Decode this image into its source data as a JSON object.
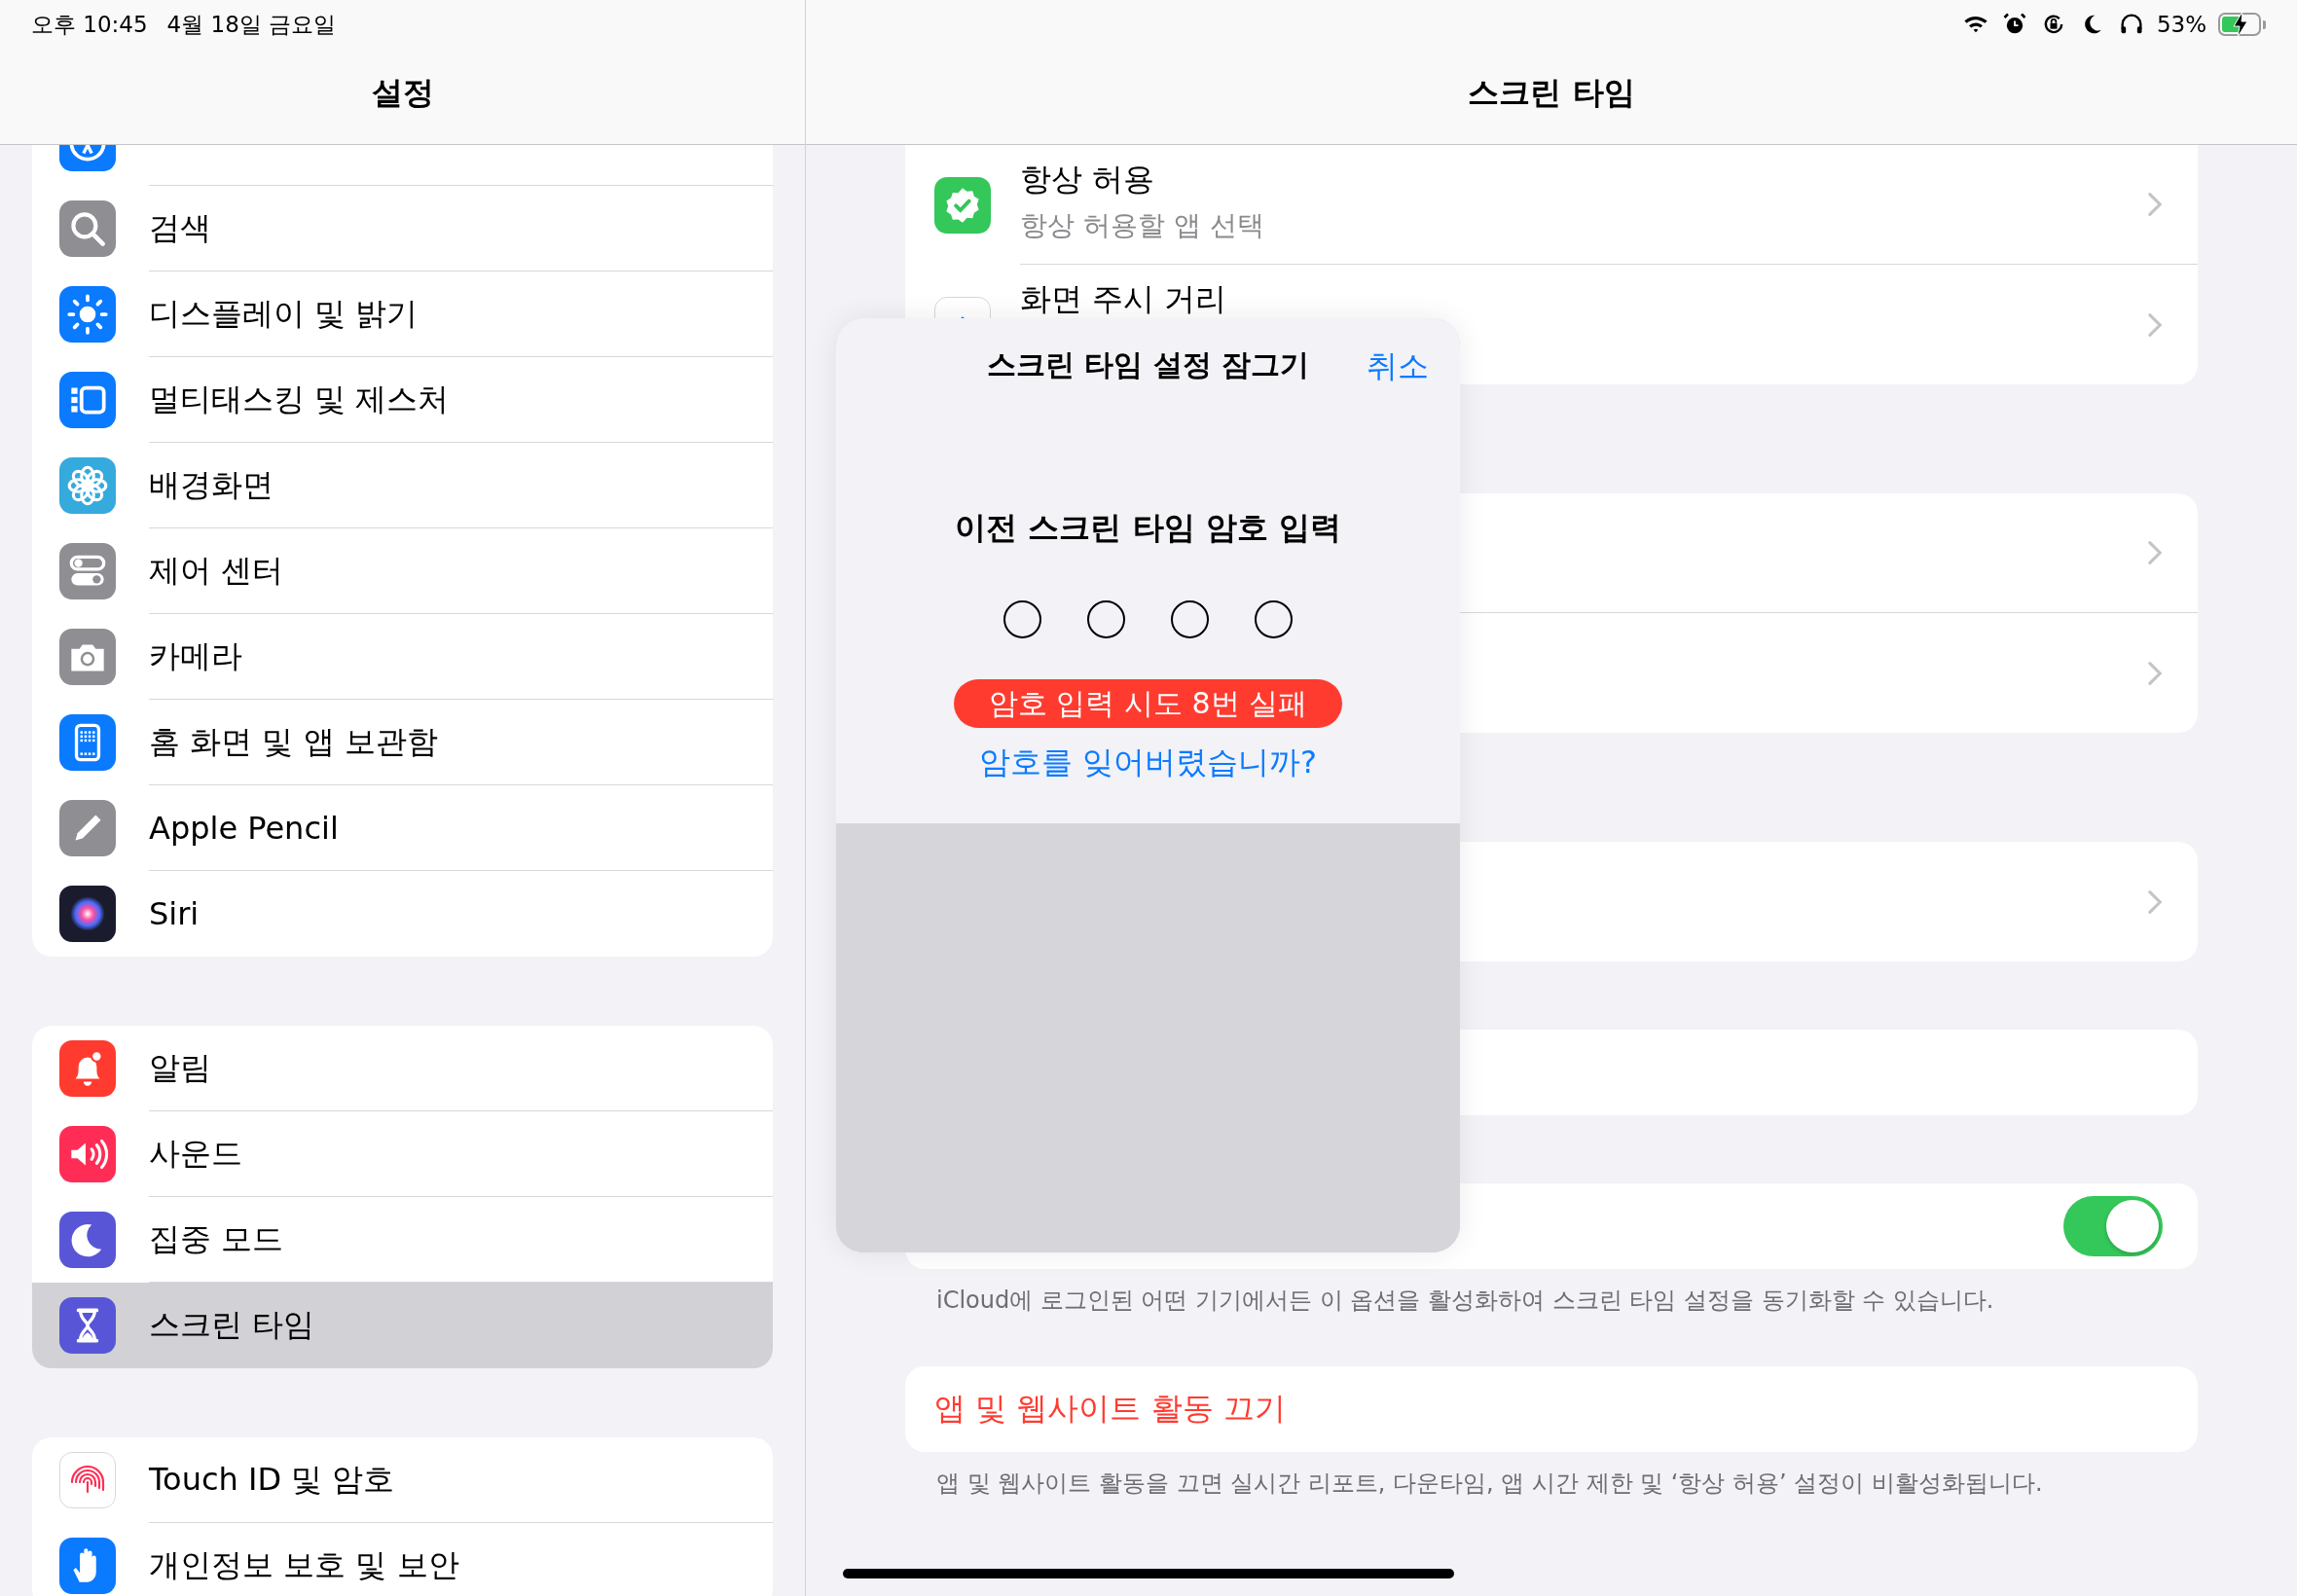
{
  "status_bar": {
    "time": "오후 10:45",
    "date": "4월 18일 금요일",
    "battery": "53%"
  },
  "sidebar": {
    "title": "설정",
    "groups": [
      {
        "items": [
          {
            "selected": false
          },
          {
            "label": "검색",
            "selected": false
          },
          {
            "label": "디스플레이 및 밝기",
            "selected": false
          },
          {
            "label": "멀티태스킹 및 제스처",
            "selected": false
          },
          {
            "label": "배경화면",
            "selected": false
          },
          {
            "label": "제어 센터",
            "selected": false
          },
          {
            "label": "카메라",
            "selected": false
          },
          {
            "label": "홈 화면 및 앱 보관함",
            "selected": false
          },
          {
            "label": "Apple Pencil",
            "selected": false
          },
          {
            "label": "Siri",
            "selected": false
          }
        ]
      },
      {
        "items": [
          {
            "label": "알림",
            "selected": false
          },
          {
            "label": "사운드",
            "selected": false
          },
          {
            "label": "집중 모드",
            "selected": false
          },
          {
            "label": "스크린 타임",
            "selected": true
          }
        ]
      },
      {
        "items": [
          {
            "label": "Touch ID 및 암호",
            "selected": false
          },
          {
            "label": "개인정보 보호 및 보안",
            "selected": false
          }
        ]
      }
    ]
  },
  "detail": {
    "title": "스크린 타임",
    "sections": [
      {
        "rows": [
          {
            "kind": "link",
            "title": "항상 허용",
            "subtitle": "항상 허용할 앱 선택"
          },
          {
            "kind": "link",
            "title": "화면 주시 거리"
          }
        ]
      },
      {
        "rows": [
          {
            "kind": "link"
          },
          {
            "kind": "link"
          }
        ]
      },
      {
        "rows": [
          {
            "kind": "link"
          }
        ]
      },
      {
        "rows": [
          {
            "kind": "plain"
          }
        ]
      },
      {
        "rows": [
          {
            "kind": "toggle",
            "on": true
          }
        ],
        "footer": "iCloud에 로그인된 어떤 기기에서든 이 옵션을 활성화하여 스크린 타임 설정을 동기화할 수 있습니다."
      },
      {
        "rows": [
          {
            "kind": "action",
            "title": "앱 및 웹사이트 활동 끄기"
          }
        ],
        "footer": "앱 및 웹사이트 활동을 끄면 실시간 리포트, 다운타임, 앱 시간 제한 및 ‘항상 허용’ 설정이 비활성화됩니다."
      }
    ]
  },
  "modal": {
    "title": "스크린 타임 설정 잠그기",
    "cancel": "취소",
    "prompt": "이전 스크린 타임 암호 입력",
    "digits": [
      {
        "filled": false
      },
      {
        "filled": false
      },
      {
        "filled": false
      },
      {
        "filled": false
      }
    ],
    "error": "암호 입력 시도 8번 실패",
    "forgot": "암호를 잊어버렸습니까?"
  }
}
